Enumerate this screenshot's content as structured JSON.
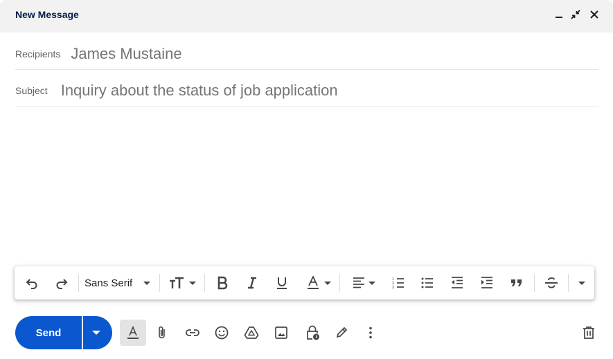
{
  "window": {
    "title": "New Message",
    "minimize_icon": "minimize-icon",
    "exit_fullscreen_icon": "exit-fullscreen-icon",
    "close_icon": "close-icon"
  },
  "fields": {
    "recipients_label": "Recipients",
    "recipients_value": "James Mustaine",
    "subject_label": "Subject",
    "subject_value": "Inquiry about the status of job application"
  },
  "formatting": {
    "font_family": "Sans Serif",
    "icons": [
      "undo-icon",
      "redo-icon",
      "text-size-icon",
      "bold-icon",
      "italic-icon",
      "underline-icon",
      "text-color-icon",
      "align-icon",
      "numbered-list-icon",
      "bulleted-list-icon",
      "indent-less-icon",
      "indent-more-icon",
      "quote-icon",
      "strikethrough-icon",
      "more-formatting-icon"
    ]
  },
  "bottom_bar": {
    "send_label": "Send",
    "icons": [
      "formatting-options-icon",
      "attach-icon",
      "link-icon",
      "emoji-icon",
      "drive-icon",
      "photo-icon",
      "confidential-mode-icon",
      "signature-icon",
      "more-options-icon",
      "discard-icon"
    ]
  },
  "colors": {
    "send_button": "#0b57d0",
    "header_bg": "#f2f2f2",
    "title": "#041e49"
  }
}
